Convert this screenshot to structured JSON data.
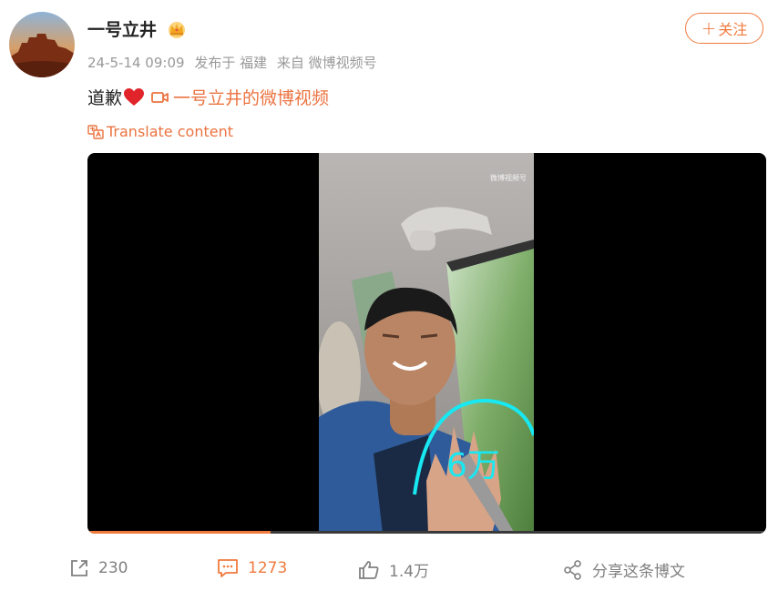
{
  "post": {
    "username": "一号立井",
    "meta": {
      "time": "24-5-14 09:09",
      "posted_from_label": "发布于 福建",
      "source": "来自 微博视频号"
    },
    "text": "道歉",
    "video_link_label": "一号立井的微博视频",
    "translate_label": "Translate content",
    "follow_label": "关注",
    "video": {
      "watermark_text": "微博视频号",
      "handwriting_text": "6万",
      "progress_fraction": 0.27
    }
  },
  "actions": {
    "share_count": "230",
    "comment_count": "1273",
    "like_count": "1.4万",
    "share_to_label": "分享这条博文"
  },
  "colors": {
    "accent": "#eb7340",
    "muted": "#999999"
  }
}
